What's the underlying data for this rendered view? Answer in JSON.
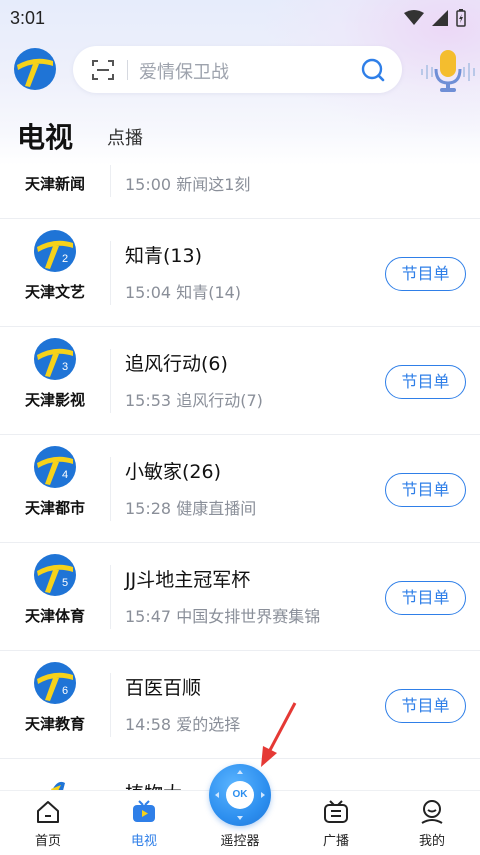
{
  "status_bar": {
    "time": "3:01"
  },
  "search": {
    "placeholder": "爱情保卫战"
  },
  "tabs": {
    "tv": "电视",
    "vod": "点播"
  },
  "channels": [
    {
      "name": "天津新闻",
      "number": "",
      "current": "",
      "next": "15:00 新闻这1刻",
      "button": ""
    },
    {
      "name": "天津文艺",
      "number": "2",
      "current": "知青(13)",
      "next": "15:04 知青(14)",
      "button": "节目单"
    },
    {
      "name": "天津影视",
      "number": "3",
      "current": "追风行动(6)",
      "next": "15:53 追风行动(7)",
      "button": "节目单"
    },
    {
      "name": "天津都市",
      "number": "4",
      "current": "小敏家(26)",
      "next": "15:28 健康直播间",
      "button": "节目单"
    },
    {
      "name": "天津体育",
      "number": "5",
      "current": "JJ斗地主冠军杯",
      "next": "15:47 中国女排世界赛集锦",
      "button": "节目单"
    },
    {
      "name": "天津教育",
      "number": "6",
      "current": "百医百顺",
      "next": "14:58 爱的选择",
      "button": "节目单"
    },
    {
      "name": "",
      "number": "",
      "current": "植物大… …织",
      "next": "",
      "button": ""
    }
  ],
  "bottom_nav": {
    "home": "首页",
    "tv": "电视",
    "remote": "遥控器",
    "remote_center": "OK",
    "radio": "广播",
    "mine": "我的"
  },
  "colors": {
    "accent": "#2f7fe8",
    "annotation": "#e53935"
  },
  "icons": [
    "scan-icon",
    "search-icon",
    "microphone-icon",
    "home-icon",
    "tv-icon",
    "radio-icon",
    "profile-icon"
  ]
}
